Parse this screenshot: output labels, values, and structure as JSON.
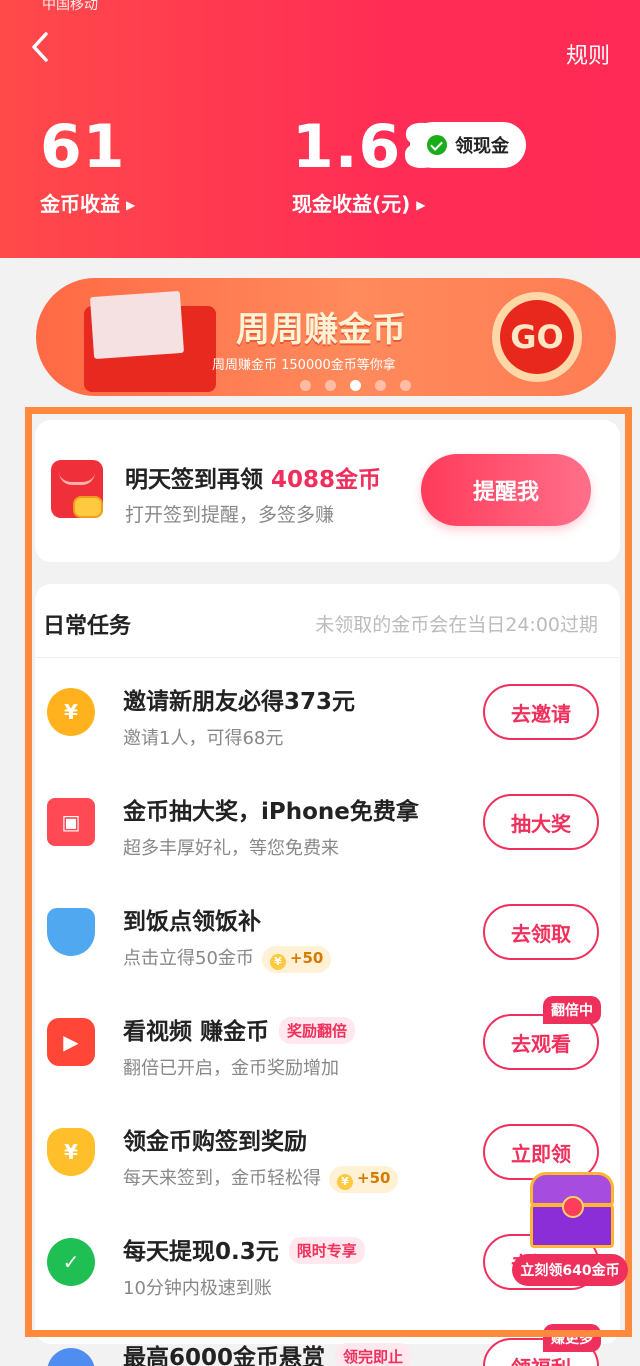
{
  "status": {
    "carrier": "中国移动"
  },
  "header": {
    "rules": "规则",
    "coin_value": "61",
    "coin_label": "金币收益",
    "cash_value": "1.68",
    "cash_label": "现金收益(元)",
    "cash_button": "领现金"
  },
  "banner": {
    "title": "周周赚金币",
    "subtitle": "周周赚金币 150000金币等你拿",
    "go": "GO",
    "dots": 5,
    "active_dot": 3
  },
  "signin": {
    "title_prefix": "明天签到再领",
    "title_highlight": "4088金币",
    "subtitle": "打开签到提醒，多签多赚",
    "button": "提醒我"
  },
  "tasks": {
    "heading": "日常任务",
    "note": "未领取的金币会在当日24:00过期",
    "items": [
      {
        "title": "邀请新朋友必得373元",
        "desc": "邀请1人，可得68元",
        "button": "去邀请",
        "icon": "yen-coin-icon",
        "color": "#ffb21e"
      },
      {
        "title": "金币抽大奖，iPhone免费拿",
        "desc": "超多丰厚好礼，等您免费来",
        "button": "抽大奖",
        "icon": "gift-icon",
        "color": "#ff4a55"
      },
      {
        "title": "到饭点领饭补",
        "desc": "点击立得50金币",
        "badge": "+50",
        "button": "去领取",
        "icon": "rice-bowl-icon",
        "color": "#4fa8f0"
      },
      {
        "title": "看视频 赚金币",
        "tag": "奖励翻倍",
        "desc": "翻倍已开启，金币奖励增加",
        "button": "去观看",
        "hot": "翻倍中",
        "icon": "video-play-icon",
        "color": "#ff4637"
      },
      {
        "title": "领金币购签到奖励",
        "desc": "每天来签到，金币轻松得",
        "badge": "+50",
        "button": "立即领",
        "icon": "money-bag-icon",
        "color": "#ffbf2a"
      },
      {
        "title": "每天提现0.3元",
        "tag": "限时专享",
        "desc": "10分钟内极速到账",
        "button": "去提现",
        "icon": "wechat-pay-icon",
        "color": "#1fbf53"
      },
      {
        "title": "最高6000金币悬赏",
        "tag": "领完即止",
        "button": "领福利",
        "hot": "赚更多",
        "icon": "reward-icon",
        "color": "#4f8ef0"
      }
    ]
  },
  "floating": {
    "label": "立刻领640金币"
  }
}
